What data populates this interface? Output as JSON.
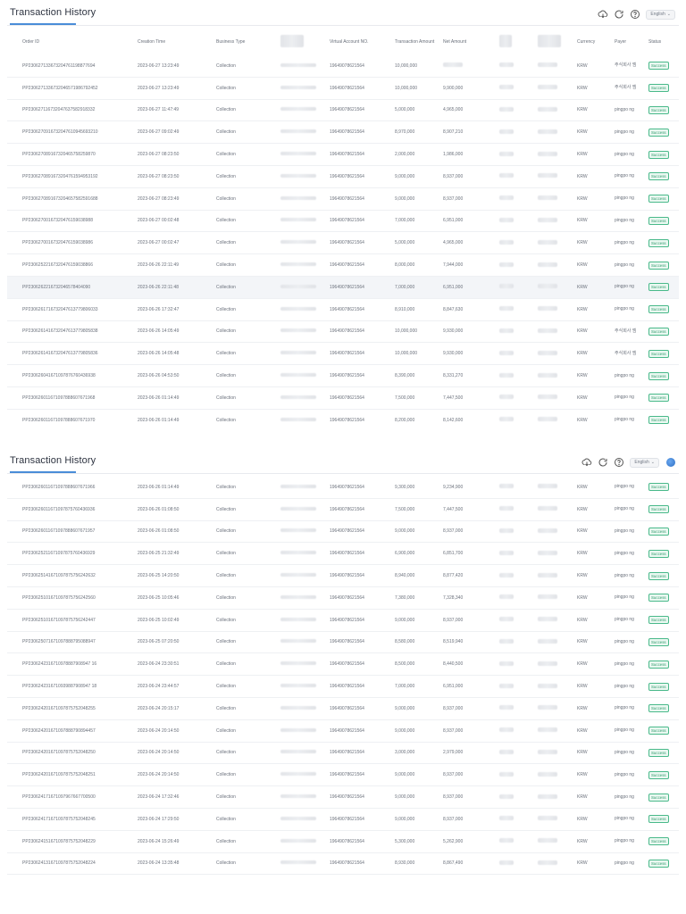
{
  "header": {
    "title": "Transaction History",
    "language": "English"
  },
  "columns": {
    "order_id": "Order ID",
    "creation_time": "Creation Time",
    "business_type": "Business Type",
    "virtual_account": "Virtual Account NO.",
    "transaction_amount": "Transaction Amount",
    "net_amount": "Net Amount",
    "currency": "Currency",
    "payer": "Payer",
    "status": "Status"
  },
  "colors": {
    "accent": "#4a8dd8",
    "success_border": "#49b98a",
    "success_text": "#2f9a6c"
  },
  "icons": [
    "cloud-download-icon",
    "refresh-icon",
    "help-icon",
    "chevron-down-icon"
  ],
  "table1": [
    {
      "order_id": "PP230627133673204761198877694",
      "time": "2023-06-27 13:23:49",
      "type": "Collection",
      "vacc": "19649078621564",
      "tamt": "10,000,000",
      "namt": "",
      "cur": "KRW",
      "payer": "주식회사 엠",
      "status": "Success"
    },
    {
      "order_id": "PP2306271336732046571986792452",
      "time": "2023-06-27 13:23:49",
      "type": "Collection",
      "vacc": "19649078621564",
      "tamt": "10,000,000",
      "namt": "9,900,000",
      "cur": "KRW",
      "payer": "주식회사 엠",
      "status": "Success"
    },
    {
      "order_id": "PP230627116732047637582918332",
      "time": "2023-06-27 11:47:49",
      "type": "Collection",
      "vacc": "19649078621564",
      "tamt": "5,000,000",
      "namt": "4,965,000",
      "cur": "KRW",
      "payer": "pingpo ng",
      "status": "Success"
    },
    {
      "order_id": "PP2306270916732047610945693210",
      "time": "2023-06-27 09:02:49",
      "type": "Collection",
      "vacc": "19649078621564",
      "tamt": "8,970,000",
      "namt": "8,907,210",
      "cur": "KRW",
      "payer": "pingpo ng",
      "status": "Success"
    },
    {
      "order_id": "PP230627089167320465758259870",
      "time": "2023-06-27 08:23:50",
      "type": "Collection",
      "vacc": "19649078621564",
      "tamt": "2,000,000",
      "namt": "1,986,000",
      "cur": "KRW",
      "payer": "pingpo ng",
      "status": "Success"
    },
    {
      "order_id": "PP2306270891673204761594953192",
      "time": "2023-06-27 08:23:50",
      "type": "Collection",
      "vacc": "19649078621564",
      "tamt": "9,000,000",
      "namt": "8,937,000",
      "cur": "KRW",
      "payer": "pingpo ng",
      "status": "Success"
    },
    {
      "order_id": "PP2306270891673204657582591688",
      "time": "2023-06-27 08:23:49",
      "type": "Collection",
      "vacc": "19649078621564",
      "tamt": "9,000,000",
      "namt": "8,937,000",
      "cur": "KRW",
      "payer": "pingpo ng",
      "status": "Success"
    },
    {
      "order_id": "PP23062700167320476159038988",
      "time": "2023-06-27 00:02:48",
      "type": "Collection",
      "vacc": "19649078621564",
      "tamt": "7,000,000",
      "namt": "6,951,000",
      "cur": "KRW",
      "payer": "pingpo ng",
      "status": "Success"
    },
    {
      "order_id": "PP23062700167320476159038986",
      "time": "2023-06-27 00:02:47",
      "type": "Collection",
      "vacc": "19649078621564",
      "tamt": "5,000,000",
      "namt": "4,965,000",
      "cur": "KRW",
      "payer": "pingpo ng",
      "status": "Success"
    },
    {
      "order_id": "PP23062522167320476159038866",
      "time": "2023-06-26 22:11:49",
      "type": "Collection",
      "vacc": "19649078621564",
      "tamt": "8,000,000",
      "namt": "7,944,000",
      "cur": "KRW",
      "payer": "pingpo ng",
      "status": "Success"
    },
    {
      "order_id": "PP2306262216732046578404090",
      "time": "2023-06-26 22:11:48",
      "type": "Collection",
      "vacc": "19649078621564",
      "tamt": "7,000,000",
      "namt": "6,951,000",
      "cur": "KRW",
      "payer": "pingpo ng",
      "status": "Success"
    },
    {
      "order_id": "PP2306261716732047613779806033",
      "time": "2023-06-26 17:32:47",
      "type": "Collection",
      "vacc": "19649078621564",
      "tamt": "8,910,000",
      "namt": "8,847,630",
      "cur": "KRW",
      "payer": "pingpo ng",
      "status": "Success"
    },
    {
      "order_id": "PP2306261416732047613779805838",
      "time": "2023-06-26 14:05:49",
      "type": "Collection",
      "vacc": "19649078621564",
      "tamt": "10,000,000",
      "namt": "9,930,000",
      "cur": "KRW",
      "payer": "주식회사 엠",
      "status": "Success"
    },
    {
      "order_id": "PP2306261416732047613779805836",
      "time": "2023-06-26 14:05:48",
      "type": "Collection",
      "vacc": "19649078621564",
      "tamt": "10,000,000",
      "namt": "9,930,000",
      "cur": "KRW",
      "payer": "주식회사 엠",
      "status": "Success"
    },
    {
      "order_id": "PP230626041671097876760436938",
      "time": "2023-06-26 04:53:50",
      "type": "Collection",
      "vacc": "19649078621564",
      "tamt": "8,390,000",
      "namt": "8,331,270",
      "cur": "KRW",
      "payer": "pingpo ng",
      "status": "Success"
    },
    {
      "order_id": "PP230626011671097888607671968",
      "time": "2023-06-26 01:14:49",
      "type": "Collection",
      "vacc": "19649078621564",
      "tamt": "7,500,000",
      "namt": "7,447,500",
      "cur": "KRW",
      "payer": "pingpo ng",
      "status": "Success"
    },
    {
      "order_id": "PP230626011671097888607671970",
      "time": "2023-06-26 01:14:49",
      "type": "Collection",
      "vacc": "19649078621564",
      "tamt": "8,200,000",
      "namt": "8,142,600",
      "cur": "KRW",
      "payer": "pingpo ng",
      "status": "Success"
    }
  ],
  "table2": [
    {
      "order_id": "PP230626011671097888607671966",
      "time": "2023-06-26 01:14:49",
      "type": "Collection",
      "vacc": "19649078621564",
      "tamt": "9,300,000",
      "namt": "9,234,900",
      "cur": "KRW",
      "payer": "pingpo ng",
      "status": "Success"
    },
    {
      "order_id": "PP230626011671097875760436936",
      "time": "2023-06-26 01:08:50",
      "type": "Collection",
      "vacc": "19649078621564",
      "tamt": "7,500,000",
      "namt": "7,447,500",
      "cur": "KRW",
      "payer": "pingpo ng",
      "status": "Success"
    },
    {
      "order_id": "PP230626011671097888607671957",
      "time": "2023-06-26 01:08:50",
      "type": "Collection",
      "vacc": "19649078621564",
      "tamt": "9,000,000",
      "namt": "8,937,000",
      "cur": "KRW",
      "payer": "pingpo ng",
      "status": "Success"
    },
    {
      "order_id": "PP230625211671097875760436929",
      "time": "2023-06-25 21:32:49",
      "type": "Collection",
      "vacc": "19649078621564",
      "tamt": "6,900,000",
      "namt": "6,851,700",
      "cur": "KRW",
      "payer": "pingpo ng",
      "status": "Success"
    },
    {
      "order_id": "PP230625141671097875756242632",
      "time": "2023-06-25 14:20:50",
      "type": "Collection",
      "vacc": "19649078621564",
      "tamt": "8,940,000",
      "namt": "8,877,420",
      "cur": "KRW",
      "payer": "pingpo ng",
      "status": "Success"
    },
    {
      "order_id": "PP230625101671097875756242560",
      "time": "2023-06-25 10:05:46",
      "type": "Collection",
      "vacc": "19649078621564",
      "tamt": "7,380,000",
      "namt": "7,328,340",
      "cur": "KRW",
      "payer": "pingpo ng",
      "status": "Success"
    },
    {
      "order_id": "PP230625101671097875756242447",
      "time": "2023-06-25 10:02:49",
      "type": "Collection",
      "vacc": "19649078621564",
      "tamt": "9,000,000",
      "namt": "8,937,000",
      "cur": "KRW",
      "payer": "pingpo ng",
      "status": "Success"
    },
    {
      "order_id": "PP230625071671097888795088947",
      "time": "2023-06-25 07:20:50",
      "type": "Collection",
      "vacc": "19649078621564",
      "tamt": "8,580,000",
      "namt": "8,519,940",
      "cur": "KRW",
      "payer": "pingpo ng",
      "status": "Success"
    },
    {
      "order_id": "PP2306242316710978887908947 16",
      "time": "2023-06-24 23:30:51",
      "type": "Collection",
      "vacc": "19649078621564",
      "tamt": "8,500,000",
      "namt": "8,440,500",
      "cur": "KRW",
      "payer": "pingpo ng",
      "status": "Success"
    },
    {
      "order_id": "PP2306242316710939887908947 18",
      "time": "2023-06-24 23:44:57",
      "type": "Collection",
      "vacc": "19649078621564",
      "tamt": "7,000,000",
      "namt": "6,951,000",
      "cur": "KRW",
      "payer": "pingpo ng",
      "status": "Success"
    },
    {
      "order_id": "PP230624201671097875752048255",
      "time": "2023-06-24 20:15:17",
      "type": "Collection",
      "vacc": "19649078621564",
      "tamt": "9,000,000",
      "namt": "8,937,000",
      "cur": "KRW",
      "payer": "pingpo ng",
      "status": "Success"
    },
    {
      "order_id": "PP230624201671097888790894457",
      "time": "2023-06-24 20:14:50",
      "type": "Collection",
      "vacc": "19649078621564",
      "tamt": "9,000,000",
      "namt": "8,937,000",
      "cur": "KRW",
      "payer": "pingpo ng",
      "status": "Success"
    },
    {
      "order_id": "PP230624201671097875752048250",
      "time": "2023-06-24 20:14:50",
      "type": "Collection",
      "vacc": "19649078621564",
      "tamt": "3,000,000",
      "namt": "2,979,000",
      "cur": "KRW",
      "payer": "pingpo ng",
      "status": "Success"
    },
    {
      "order_id": "PP230624201671097875752048251",
      "time": "2023-06-24 20:14:50",
      "type": "Collection",
      "vacc": "19649078621564",
      "tamt": "9,000,000",
      "namt": "8,937,000",
      "cur": "KRW",
      "payer": "pingpo ng",
      "status": "Success"
    },
    {
      "order_id": "PP230624171671097967667700500",
      "time": "2023-06-24 17:32:46",
      "type": "Collection",
      "vacc": "19649078621564",
      "tamt": "9,000,000",
      "namt": "8,937,000",
      "cur": "KRW",
      "payer": "pingpo ng",
      "status": "Success"
    },
    {
      "order_id": "PP230624171671097875752048245",
      "time": "2023-06-24 17:29:50",
      "type": "Collection",
      "vacc": "19649078621564",
      "tamt": "9,000,000",
      "namt": "8,937,000",
      "cur": "KRW",
      "payer": "pingpo ng",
      "status": "Success"
    },
    {
      "order_id": "PP230624151671097875752048229",
      "time": "2023-06-24 15:26:49",
      "type": "Collection",
      "vacc": "19649078621564",
      "tamt": "5,300,000",
      "namt": "5,262,900",
      "cur": "KRW",
      "payer": "pingpo ng",
      "status": "Success"
    },
    {
      "order_id": "PP230624131671097875752048224",
      "time": "2023-06-24 13:35:48",
      "type": "Collection",
      "vacc": "19649078621564",
      "tamt": "8,930,000",
      "namt": "8,867,490",
      "cur": "KRW",
      "payer": "pingpo ng",
      "status": "Success"
    }
  ]
}
